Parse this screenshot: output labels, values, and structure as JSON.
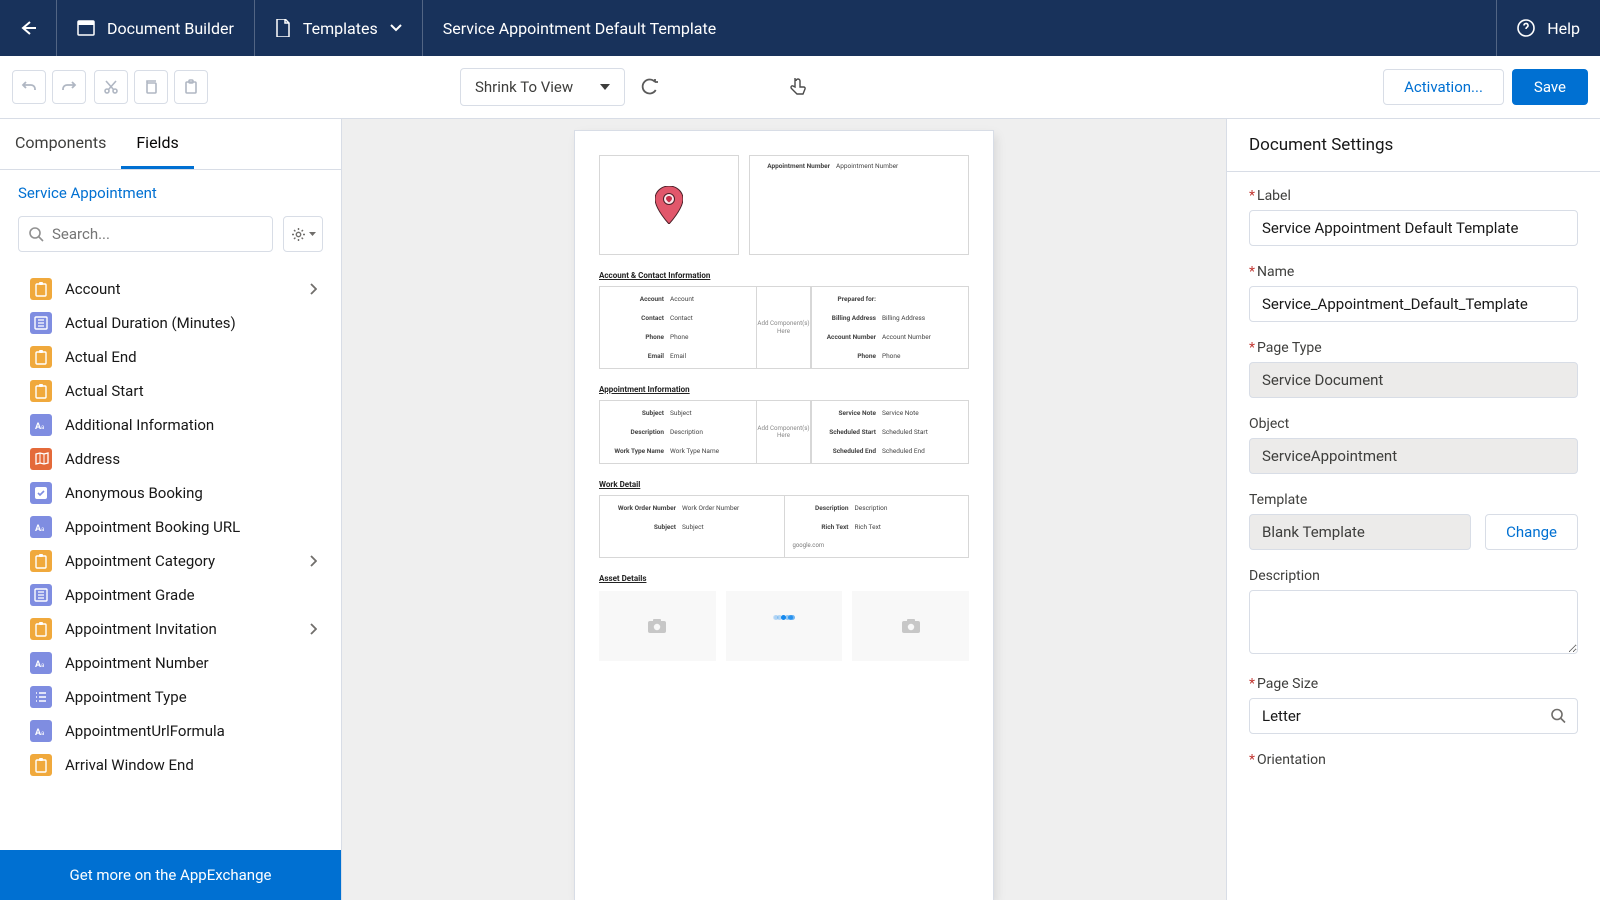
{
  "header": {
    "builder_label": "Document Builder",
    "templates_label": "Templates",
    "doc_title": "Service Appointment Default Template",
    "help_label": "Help"
  },
  "toolbar": {
    "zoom_label": "Shrink To View",
    "activation_label": "Activation...",
    "save_label": "Save"
  },
  "left": {
    "tabs": {
      "components": "Components",
      "fields": "Fields"
    },
    "object_link": "Service Appointment",
    "search_placeholder": "Search...",
    "fields": [
      {
        "label": "Account",
        "icon": "clip",
        "color": "#f0a93c",
        "children": true
      },
      {
        "label": "Actual Duration (Minutes)",
        "icon": "num",
        "color": "#7f8de1",
        "children": false
      },
      {
        "label": "Actual End",
        "icon": "clip",
        "color": "#f0a93c",
        "children": false
      },
      {
        "label": "Actual Start",
        "icon": "clip",
        "color": "#f0a93c",
        "children": false
      },
      {
        "label": "Additional Information",
        "icon": "text",
        "color": "#7f8de1",
        "children": false
      },
      {
        "label": "Address",
        "icon": "map",
        "color": "#e46a3a",
        "children": false
      },
      {
        "label": "Anonymous Booking",
        "icon": "check",
        "color": "#7f8de1",
        "children": false
      },
      {
        "label": "Appointment Booking URL",
        "icon": "text",
        "color": "#7f8de1",
        "children": false
      },
      {
        "label": "Appointment Category",
        "icon": "clip",
        "color": "#f0a93c",
        "children": true
      },
      {
        "label": "Appointment Grade",
        "icon": "num",
        "color": "#7f8de1",
        "children": false
      },
      {
        "label": "Appointment Invitation",
        "icon": "clip",
        "color": "#f0a93c",
        "children": true
      },
      {
        "label": "Appointment Number",
        "icon": "text",
        "color": "#7f8de1",
        "children": false
      },
      {
        "label": "Appointment Type",
        "icon": "list",
        "color": "#7f8de1",
        "children": false
      },
      {
        "label": "AppointmentUrlFormula",
        "icon": "text",
        "color": "#7f8de1",
        "children": false
      },
      {
        "label": "Arrival Window End",
        "icon": "clip",
        "color": "#f0a93c",
        "children": false
      }
    ],
    "appexchange": "Get more on the AppExchange"
  },
  "canvas": {
    "appt_num_k": "Appointment Number",
    "appt_num_v": "Appointment Number",
    "sec_acct": "Account & Contact Information",
    "account_k": "Account",
    "account_v": "Account",
    "contact_k": "Contact",
    "contact_v": "Contact",
    "phone_k": "Phone",
    "phone_v": "Phone",
    "email_k": "Email",
    "email_v": "Email",
    "prepared_for": "Prepared for:",
    "billing_k": "Billing Address",
    "billing_v": "Billing Address",
    "acctnum_k": "Account Number",
    "acctnum_v": "Account Number",
    "add_component": "Add Component(s) Here",
    "sec_appt": "Appointment Information",
    "subject_k": "Subject",
    "subject_v": "Subject",
    "desc_k": "Description",
    "desc_v": "Description",
    "wtn_k": "Work Type Name",
    "wtn_v": "Work Type Name",
    "svcnote_k": "Service Note",
    "svcnote_v": "Service Note",
    "sstart_k": "Scheduled Start",
    "sstart_v": "Scheduled Start",
    "send_k": "Scheduled End",
    "send_v": "Scheduled End",
    "sec_work": "Work Detail",
    "won_k": "Work Order Number",
    "won_v": "Work Order Number",
    "rich_k": "Rich Text",
    "rich_v": "Rich Text",
    "google": "google.com",
    "sec_asset": "Asset Details"
  },
  "right": {
    "title": "Document Settings",
    "label_lbl": "Label",
    "label_val": "Service Appointment Default Template",
    "name_lbl": "Name",
    "name_val": "Service_Appointment_Default_Template",
    "pagetype_lbl": "Page Type",
    "pagetype_val": "Service Document",
    "object_lbl": "Object",
    "object_val": "ServiceAppointment",
    "template_lbl": "Template",
    "template_val": "Blank Template",
    "change_label": "Change",
    "desc_lbl": "Description",
    "pagesize_lbl": "Page Size",
    "pagesize_val": "Letter",
    "orientation_lbl": "Orientation"
  }
}
